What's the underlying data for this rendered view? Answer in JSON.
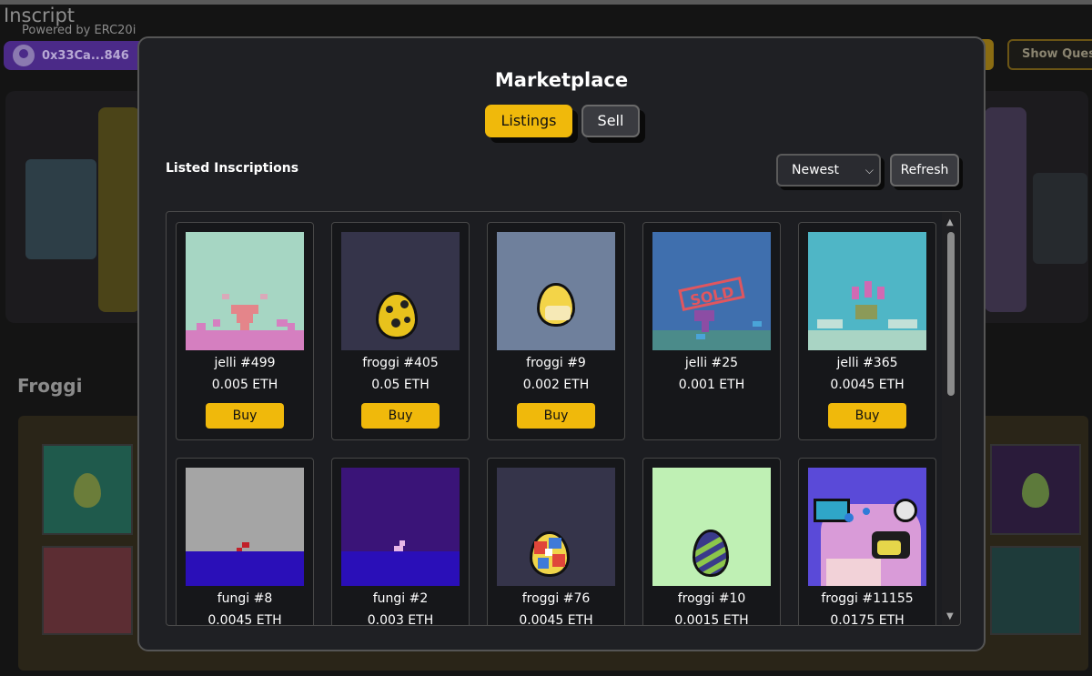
{
  "background": {
    "app_title": "Inscript",
    "powered_by": "Powered by ERC20i",
    "wallet_address": "0x33Ca...846",
    "quest_button": "Show Ques",
    "section_title": "Froggi"
  },
  "modal": {
    "title": "Marketplace",
    "tabs": [
      {
        "label": "Listings",
        "active": true
      },
      {
        "label": "Sell",
        "active": false
      }
    ],
    "section_label": "Listed Inscriptions",
    "sort": {
      "selected": "Newest"
    },
    "refresh_label": "Refresh",
    "buy_label": "Buy",
    "sold_stamp": "SOLD",
    "listings": [
      {
        "name": "jelli #499",
        "price": "0.005 ETH",
        "can_buy": true
      },
      {
        "name": "froggi #405",
        "price": "0.05 ETH",
        "can_buy": true
      },
      {
        "name": "froggi #9",
        "price": "0.002 ETH",
        "can_buy": true
      },
      {
        "name": "jelli #25",
        "price": "0.001 ETH",
        "can_buy": false,
        "sold": true
      },
      {
        "name": "jelli #365",
        "price": "0.0045 ETH",
        "can_buy": true
      },
      {
        "name": "fungi #8",
        "price": "0.0045 ETH"
      },
      {
        "name": "fungi #2",
        "price": "0.003 ETH"
      },
      {
        "name": "froggi #76",
        "price": "0.0045 ETH"
      },
      {
        "name": "froggi #10",
        "price": "0.0015 ETH"
      },
      {
        "name": "froggi #11155",
        "price": "0.0175 ETH"
      }
    ]
  },
  "colors": {
    "accent": "#f0b90b",
    "modal_bg": "#1f2024",
    "wallet_bg": "#4b2a88"
  }
}
